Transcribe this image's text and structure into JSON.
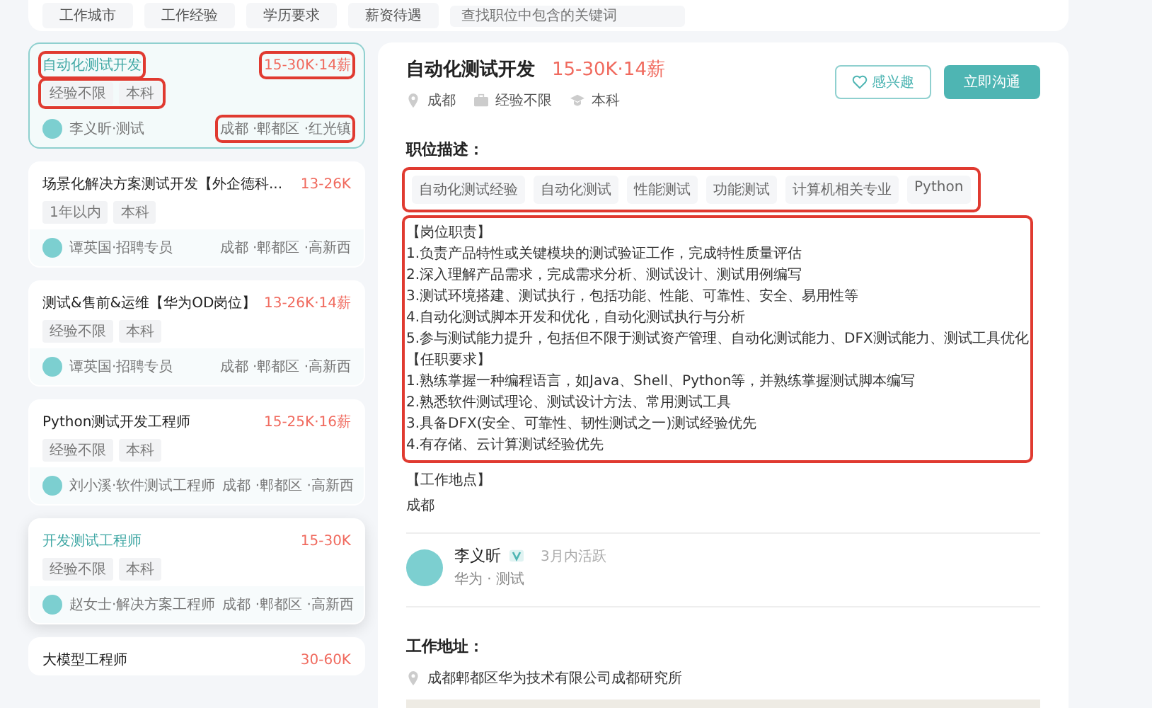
{
  "filters": {
    "items": [
      "工作城市",
      "工作经验",
      "学历要求",
      "薪资待遇"
    ],
    "search": {
      "placeholder": "查找职位中包含的关键词"
    }
  },
  "jobs": [
    {
      "title": "自动化测试开发",
      "salary": "15-30K·14薪",
      "tags": [
        "经验不限",
        "本科"
      ],
      "recruiter": "李义昕·测试",
      "location": "成都 ·郫都区 ·红光镇",
      "selected": true,
      "hovered": false,
      "highlighted": true
    },
    {
      "title": "场景化解决方案测试开发【外企德科...",
      "salary": "13-26K",
      "tags": [
        "1年以内",
        "本科"
      ],
      "recruiter": "谭英国·招聘专员",
      "location": "成都 ·郫都区 ·高新西",
      "selected": false,
      "hovered": false,
      "highlighted": false
    },
    {
      "title": "测试&售前&运维【华为OD岗位】",
      "salary": "13-26K·14薪",
      "tags": [
        "经验不限",
        "本科"
      ],
      "recruiter": "谭英国·招聘专员",
      "location": "成都 ·郫都区 ·高新西",
      "selected": false,
      "hovered": false,
      "highlighted": false
    },
    {
      "title": "Python测试开发工程师",
      "salary": "15-25K·16薪",
      "tags": [
        "经验不限",
        "本科"
      ],
      "recruiter": "刘小溪·软件测试工程师",
      "location": "成都 ·郫都区 ·高新西",
      "selected": false,
      "hovered": false,
      "highlighted": false
    },
    {
      "title": "开发测试工程师",
      "salary": "15-30K",
      "tags": [
        "经验不限",
        "本科"
      ],
      "recruiter": "赵女士·解决方案工程师",
      "location": "成都 ·郫都区 ·高新西",
      "selected": false,
      "hovered": true,
      "highlighted": false
    },
    {
      "title": "大模型工程师",
      "salary": "30-60K",
      "selected": false,
      "hovered": false,
      "highlighted": false
    }
  ],
  "detail": {
    "title": "自动化测试开发",
    "salary": "15-30K·14薪",
    "city": "成都",
    "experience": "经验不限",
    "education": "本科",
    "interest_button": "感兴趣",
    "chat_button": "立即沟通",
    "description_heading": "职位描述：",
    "skills": [
      "自动化测试经验",
      "自动化测试",
      "性能测试",
      "功能测试",
      "计算机相关专业",
      "Python"
    ],
    "skills_highlighted": true,
    "description_lines": [
      "【岗位职责】",
      "1.负责产品特性或关键模块的测试验证工作，完成特性质量评估",
      "2.深入理解产品需求，完成需求分析、测试设计、测试用例编写",
      "3.测试环境搭建、测试执行，包括功能、性能、可靠性、安全、易用性等",
      "4.自动化测试脚本开发和优化，自动化测试执行与分析",
      "5.参与测试能力提升，包括但不限于测试资产管理、自动化测试能力、DFX测试能力、测试工具优化",
      "【任职要求】",
      "1.熟练掌握一种编程语言，如Java、Shell、Python等，并熟练掌握测试脚本编写",
      "2.熟悉软件测试理论、测试设计方法、常用测试工具",
      "3.具备DFX(安全、可靠性、韧性测试之一)测试经验优先",
      "4.有存储、云计算测试经验优先"
    ],
    "description_highlighted": true,
    "workplace_heading": "【工作地点】",
    "workplace": "成都",
    "recruiter": {
      "name": "李义昕",
      "verified": true,
      "active": "3月内活跃",
      "company": "华为 · 测试"
    },
    "address_heading": "工作地址：",
    "address": "成都郫都区华为技术有限公司成都研究所"
  }
}
